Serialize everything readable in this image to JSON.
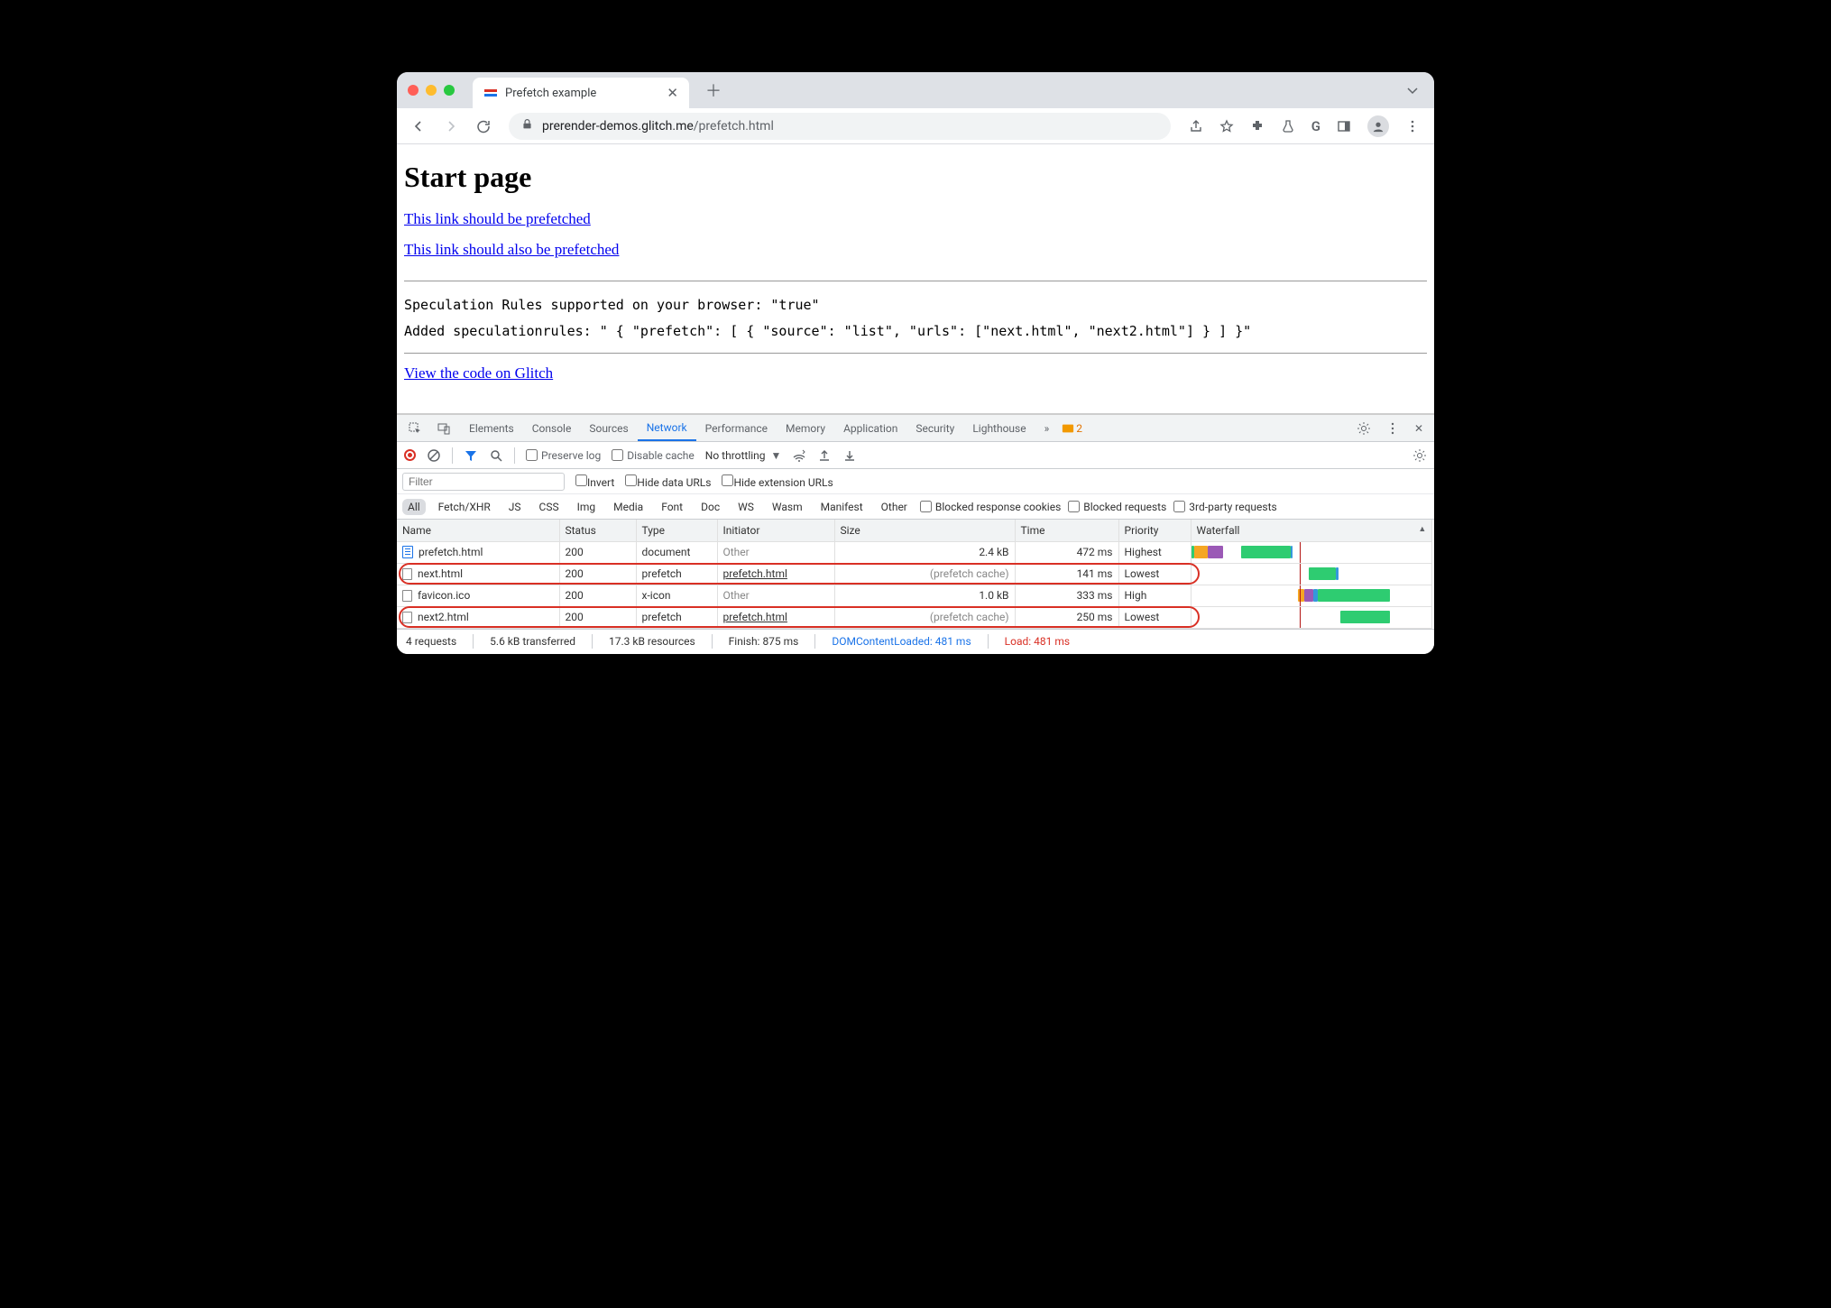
{
  "tab": {
    "title": "Prefetch example"
  },
  "url": {
    "host": "prerender-demos.glitch.me",
    "path": "/prefetch.html"
  },
  "page": {
    "heading": "Start page",
    "link1": "This link should be prefetched",
    "link2": "This link should also be prefetched",
    "mono1": "Speculation Rules supported on your browser: \"true\"",
    "mono2": "Added speculationrules: \" { \"prefetch\": [ { \"source\": \"list\", \"urls\": [\"next.html\", \"next2.html\"] } ] }\"",
    "link3": "View the code on Glitch"
  },
  "devtools": {
    "tabs": [
      "Elements",
      "Console",
      "Sources",
      "Network",
      "Performance",
      "Memory",
      "Application",
      "Security",
      "Lighthouse"
    ],
    "warnCount": "2",
    "toolbar": {
      "preserve": "Preserve log",
      "disableCache": "Disable cache",
      "throttling": "No throttling"
    },
    "filter": {
      "placeholder": "Filter",
      "invert": "Invert",
      "hideData": "Hide data URLs",
      "hideExt": "Hide extension URLs"
    },
    "types": [
      "All",
      "Fetch/XHR",
      "JS",
      "CSS",
      "Img",
      "Media",
      "Font",
      "Doc",
      "WS",
      "Wasm",
      "Manifest",
      "Other"
    ],
    "typeOpts": {
      "blockedResp": "Blocked response cookies",
      "blockedReq": "Blocked requests",
      "thirdParty": "3rd-party requests"
    },
    "columns": [
      "Name",
      "Status",
      "Type",
      "Initiator",
      "Size",
      "Time",
      "Priority",
      "Waterfall"
    ],
    "rows": [
      {
        "name": "prefetch.html",
        "status": "200",
        "type": "document",
        "initiator": "Other",
        "initiatorOther": true,
        "size": "2.4 kB",
        "time": "472 ms",
        "priority": "Highest",
        "doc": true,
        "highlight": false,
        "wf": {
          "left": 0,
          "segs": [
            [
              "#2ecc71",
              0,
              3
            ],
            [
              "#f5a623",
              3,
              18
            ],
            [
              "#9b59b6",
              18,
              35
            ],
            [
              "#2ecc71",
              55,
              110
            ],
            [
              "#3498db",
              110,
              112
            ]
          ]
        }
      },
      {
        "name": "next.html",
        "status": "200",
        "type": "prefetch",
        "initiator": "prefetch.html",
        "initiatorOther": false,
        "size": "(prefetch cache)",
        "cache": true,
        "time": "141 ms",
        "priority": "Lowest",
        "doc": false,
        "highlight": true,
        "wf": {
          "left": 0,
          "segs": [
            [
              "#2ecc71",
              130,
              160
            ],
            [
              "#3498db",
              160,
              163
            ]
          ]
        }
      },
      {
        "name": "favicon.ico",
        "status": "200",
        "type": "x-icon",
        "initiator": "Other",
        "initiatorOther": true,
        "size": "1.0 kB",
        "time": "333 ms",
        "priority": "High",
        "doc": false,
        "highlight": false,
        "wf": {
          "left": 0,
          "segs": [
            [
              "#f5a623",
              118,
              125
            ],
            [
              "#9b59b6",
              125,
              135
            ],
            [
              "#3498db",
              135,
              140
            ],
            [
              "#2ecc71",
              140,
              220
            ]
          ]
        }
      },
      {
        "name": "next2.html",
        "status": "200",
        "type": "prefetch",
        "initiator": "prefetch.html",
        "initiatorOther": false,
        "size": "(prefetch cache)",
        "cache": true,
        "time": "250 ms",
        "priority": "Lowest",
        "doc": false,
        "highlight": true,
        "wf": {
          "left": 0,
          "segs": [
            [
              "#2ecc71",
              165,
              220
            ]
          ]
        }
      }
    ],
    "status": {
      "requests": "4 requests",
      "transferred": "5.6 kB transferred",
      "resources": "17.3 kB resources",
      "finish": "Finish: 875 ms",
      "dcl": "DOMContentLoaded: 481 ms",
      "load": "Load: 481 ms"
    }
  }
}
